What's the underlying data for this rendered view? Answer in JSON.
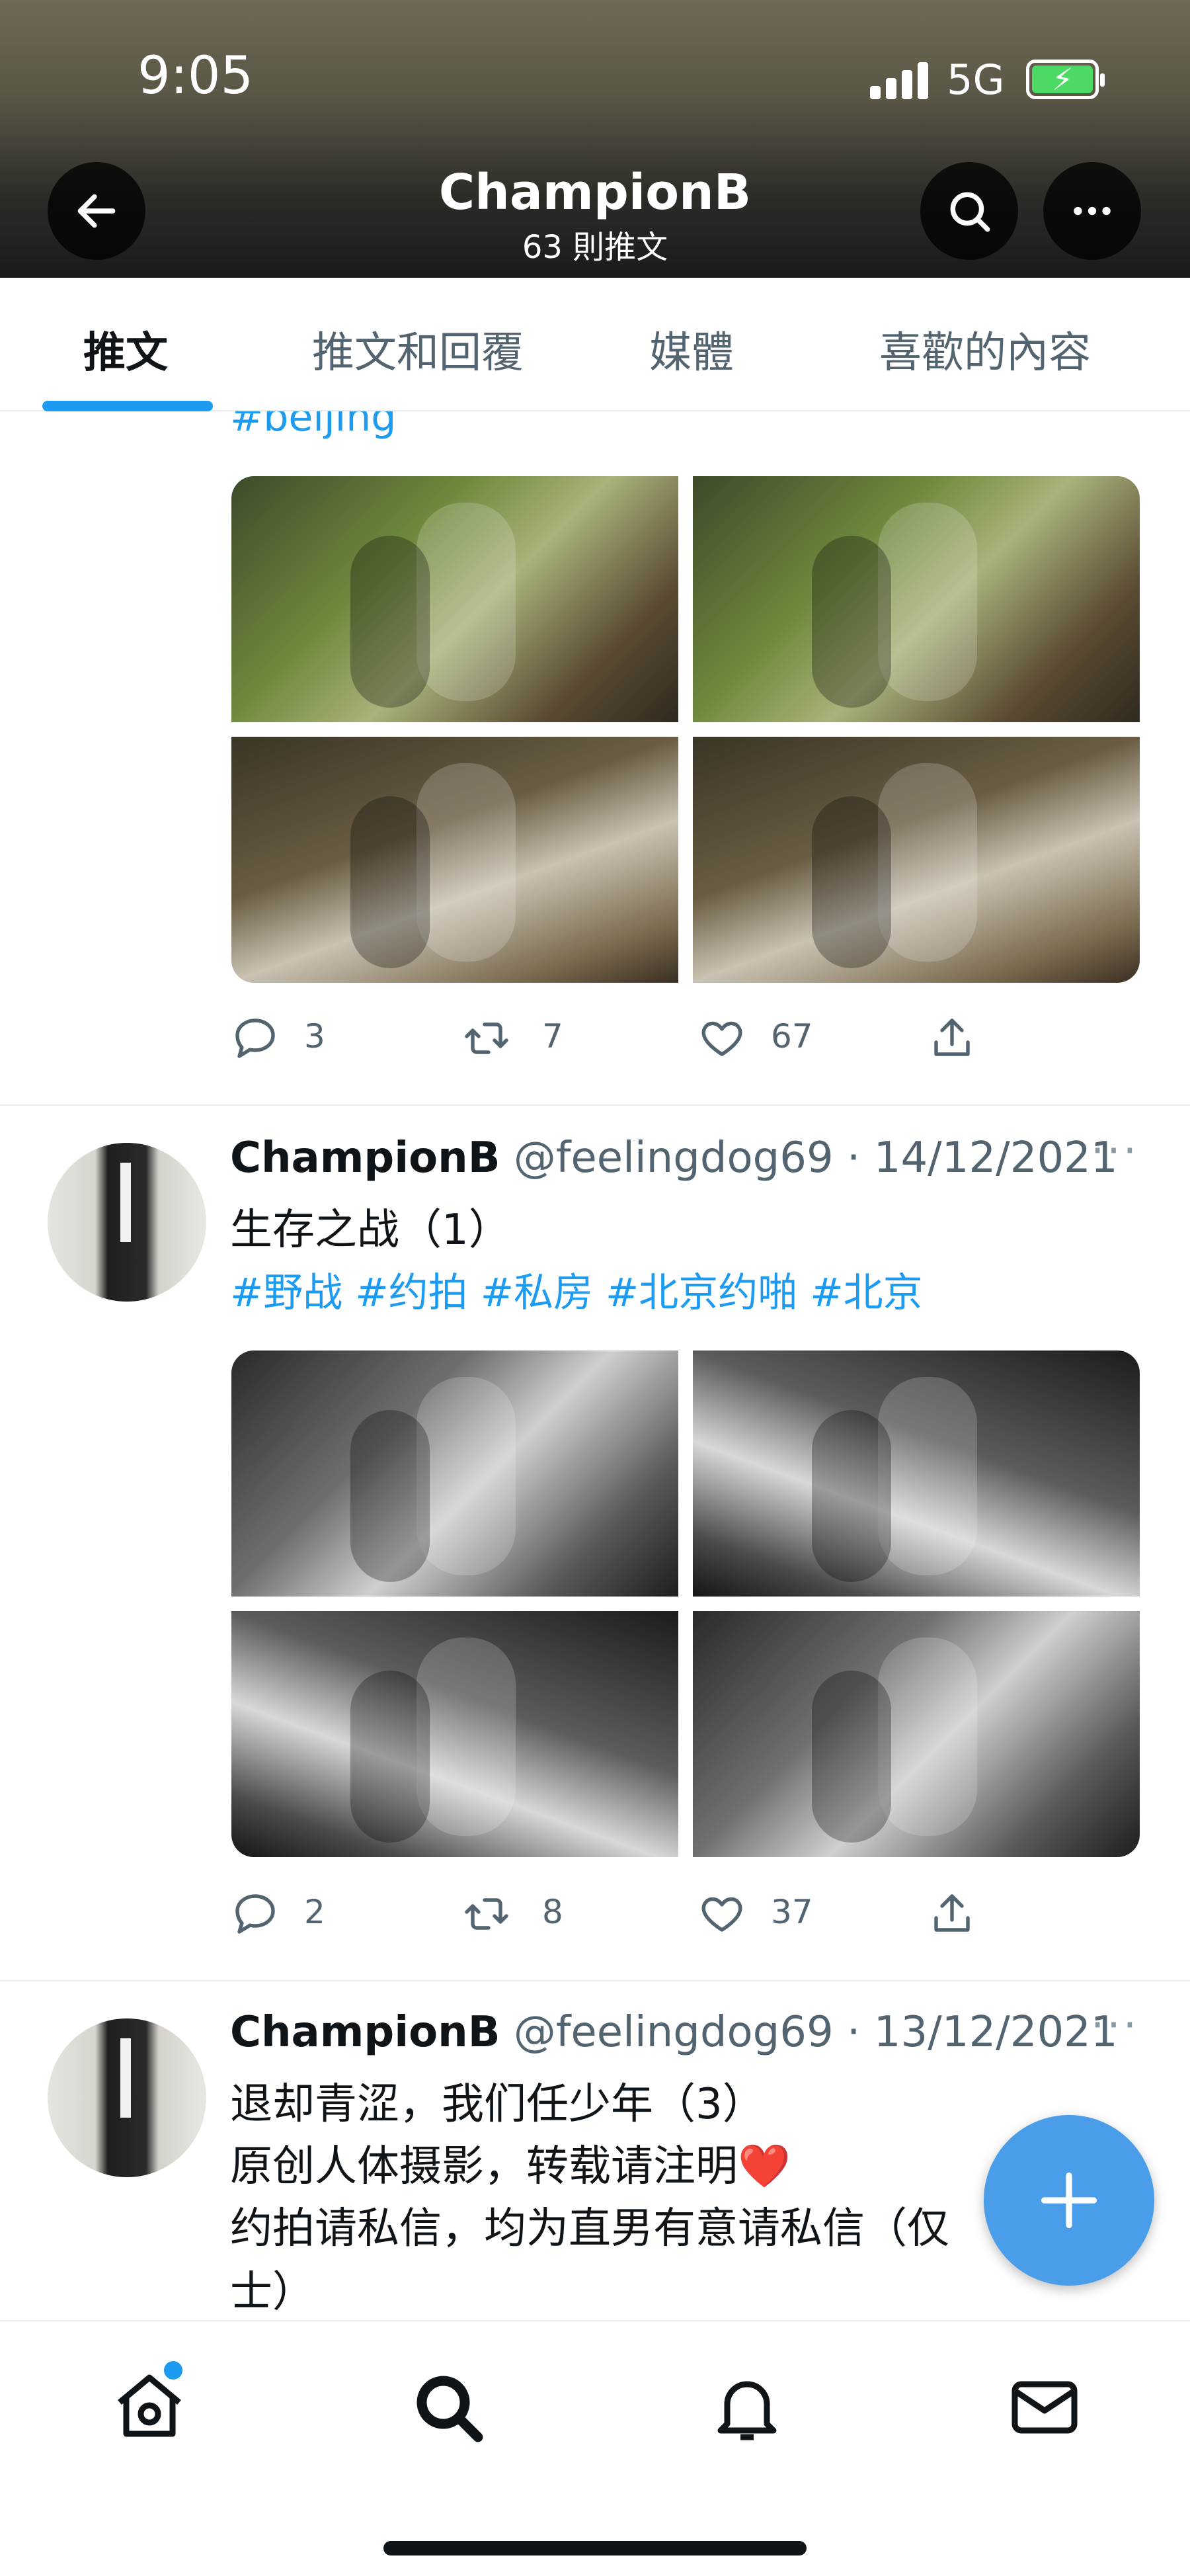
{
  "status_bar": {
    "time": "9:05",
    "network": "5G"
  },
  "header": {
    "title": "ChampionB",
    "subtitle": "63 則推文"
  },
  "tabs": [
    {
      "label": "推文",
      "active": true
    },
    {
      "label": "推文和回覆",
      "active": false
    },
    {
      "label": "媒體",
      "active": false
    },
    {
      "label": "喜歡的內容",
      "active": false
    }
  ],
  "tweets": [
    {
      "hashtags_partial": "#beijing",
      "media_style": "color",
      "replies": "3",
      "retweets": "7",
      "likes": "67"
    },
    {
      "name": "ChampionB",
      "handle": "@feelingdog69",
      "separator": "·",
      "date": "14/12/2021",
      "text": "生存之战（1）",
      "hashtags": "#野战 #约拍 #私房 #北京约啪 #北京",
      "media_style": "bw",
      "replies": "2",
      "retweets": "8",
      "likes": "37"
    },
    {
      "name": "ChampionB",
      "handle": "@feelingdog69",
      "separator": "·",
      "date": "13/12/2021",
      "line1": "退却青涩，我们任少年（3）",
      "line2": "原创人体摄影，转载请注明",
      "line2_emoji": "❤️",
      "line3": "约拍请私信，均为直男有意请私信（仅",
      "line4": "士）"
    }
  ],
  "colors": {
    "accent": "#1d9bf0",
    "fab": "#4a9de8",
    "text": "#0f1419",
    "muted": "#536471"
  },
  "icons": [
    "back-arrow-icon",
    "search-icon",
    "more-icon",
    "reply-icon",
    "retweet-icon",
    "like-icon",
    "share-icon",
    "home-icon",
    "explore-search-icon",
    "notifications-icon",
    "messages-icon",
    "compose-plus-icon"
  ]
}
